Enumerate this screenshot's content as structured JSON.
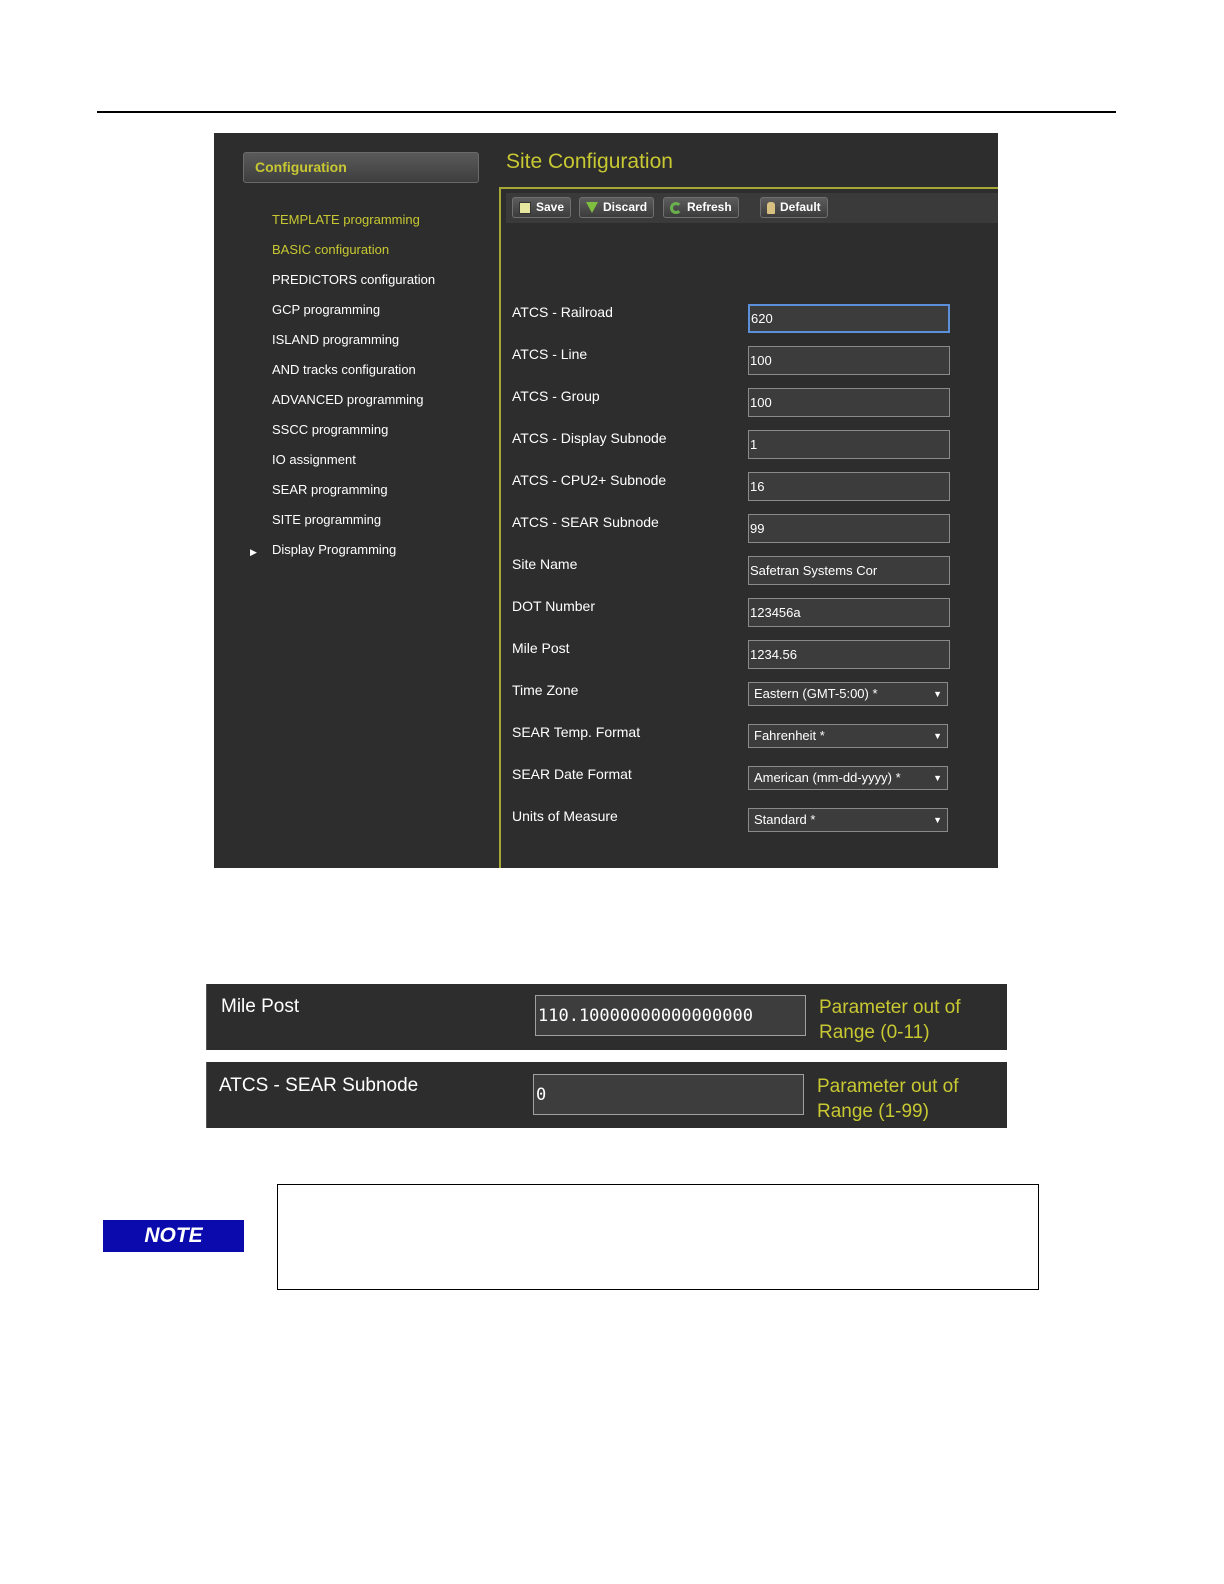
{
  "sidebar": {
    "header": "Configuration",
    "items": [
      {
        "label": "TEMPLATE programming",
        "style": "yellow"
      },
      {
        "label": "BASIC configuration",
        "style": "yellow"
      },
      {
        "label": "PREDICTORS configuration",
        "style": "white"
      },
      {
        "label": "GCP programming",
        "style": "white"
      },
      {
        "label": "ISLAND programming",
        "style": "white"
      },
      {
        "label": "AND tracks configuration",
        "style": "white"
      },
      {
        "label": "ADVANCED programming",
        "style": "white"
      },
      {
        "label": "SSCC programming",
        "style": "white"
      },
      {
        "label": "IO assignment",
        "style": "white"
      },
      {
        "label": "SEAR programming",
        "style": "white"
      },
      {
        "label": "SITE programming",
        "style": "white"
      },
      {
        "label": "Display Programming",
        "style": "white",
        "expander": "▶"
      }
    ]
  },
  "main": {
    "title": "Site Configuration",
    "toolbar": {
      "save": "Save",
      "discard": "Discard",
      "refresh": "Refresh",
      "default": "Default"
    },
    "fields": [
      {
        "label": "ATCS - Railroad",
        "value": "620"
      },
      {
        "label": "ATCS - Line",
        "value": "100"
      },
      {
        "label": "ATCS - Group",
        "value": "100"
      },
      {
        "label": "ATCS - Display Subnode",
        "value": "1"
      },
      {
        "label": "ATCS - CPU2+ Subnode",
        "value": "16"
      },
      {
        "label": "ATCS - SEAR Subnode",
        "value": "99"
      },
      {
        "label": "Site Name",
        "value": "Safetran Systems Cor"
      },
      {
        "label": "DOT Number",
        "value": "123456a"
      },
      {
        "label": "Mile Post",
        "value": "1234.56"
      }
    ],
    "selects": [
      {
        "label": "Time Zone",
        "value": "Eastern (GMT-5:00) *"
      },
      {
        "label": "SEAR Temp. Format",
        "value": "Fahrenheit *"
      },
      {
        "label": "SEAR Date Format",
        "value": "American (mm-dd-yyyy) *"
      },
      {
        "label": "Units of Measure",
        "value": "Standard *"
      }
    ]
  },
  "errors": [
    {
      "label": "Mile Post",
      "value": "110.10000000000000000",
      "message": "Parameter out of Range (0-11)"
    },
    {
      "label": "ATCS - SEAR Subnode",
      "value": "0",
      "message": "Parameter out of Range (1-99)"
    }
  ],
  "note": {
    "badge": "NOTE",
    "text": ""
  },
  "colors": {
    "accent_yellow": "#c8c832",
    "panel_bg": "#2d2d2d",
    "note_blue": "#0a0aad",
    "focus_blue": "#5b8fd9"
  }
}
